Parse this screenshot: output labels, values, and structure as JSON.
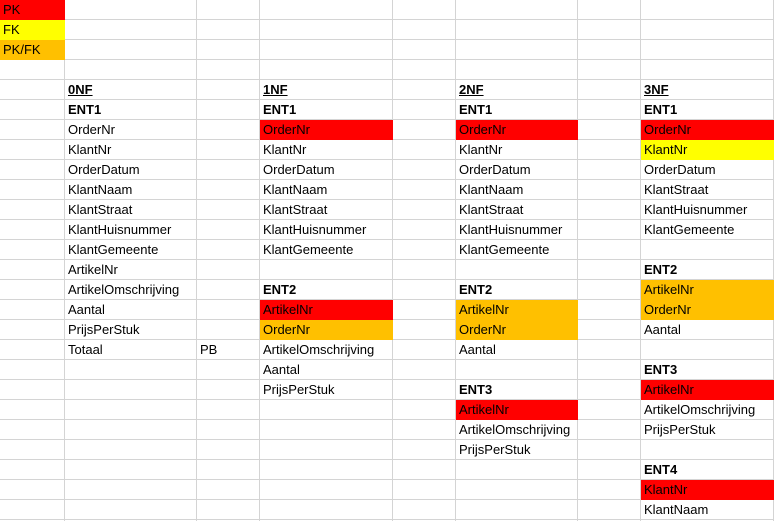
{
  "colors": {
    "pk": "#ff0000",
    "fk": "#ffff00",
    "pkfk": "#ffc000",
    "gridline": "#d4d4d4"
  },
  "legend": {
    "pk": "PK",
    "fk": "FK",
    "pkfk": "PK/FK"
  },
  "nf0": {
    "header": "0NF",
    "ent1": "ENT1",
    "fields": [
      "OrderNr",
      "KlantNr",
      "OrderDatum",
      "KlantNaam",
      "KlantStraat",
      "KlantHuisnummer",
      "KlantGemeente",
      "ArtikelNr",
      "ArtikelOmschrijving",
      "Aantal",
      "PrijsPerStuk",
      "Totaal"
    ],
    "pb": "PB"
  },
  "nf1": {
    "header": "1NF",
    "ent1": "ENT1",
    "ent1_fields": [
      "OrderNr",
      "KlantNr",
      "OrderDatum",
      "KlantNaam",
      "KlantStraat",
      "KlantHuisnummer",
      "KlantGemeente"
    ],
    "ent2": "ENT2",
    "ent2_fields": [
      "ArtikelNr",
      "OrderNr",
      "ArtikelOmschrijving",
      "Aantal",
      "PrijsPerStuk"
    ]
  },
  "nf2": {
    "header": "2NF",
    "ent1": "ENT1",
    "ent1_fields": [
      "OrderNr",
      "KlantNr",
      "OrderDatum",
      "KlantNaam",
      "KlantStraat",
      "KlantHuisnummer",
      "KlantGemeente"
    ],
    "ent2": "ENT2",
    "ent2_fields": [
      "ArtikelNr",
      "OrderNr",
      "Aantal"
    ],
    "ent3": "ENT3",
    "ent3_fields": [
      "ArtikelNr",
      "ArtikelOmschrijving",
      "PrijsPerStuk"
    ]
  },
  "nf3": {
    "header": "3NF",
    "ent1": "ENT1",
    "ent1_fields": [
      "OrderNr",
      "KlantNr",
      "OrderDatum",
      "KlantStraat",
      "KlantHuisnummer",
      "KlantGemeente"
    ],
    "ent2": "ENT2",
    "ent2_fields": [
      "ArtikelNr",
      "OrderNr",
      "Aantal"
    ],
    "ent3": "ENT3",
    "ent3_fields": [
      "ArtikelNr",
      "ArtikelOmschrijving",
      "PrijsPerStuk"
    ],
    "ent4": "ENT4",
    "ent4_fields": [
      "KlantNr",
      "KlantNaam"
    ]
  }
}
